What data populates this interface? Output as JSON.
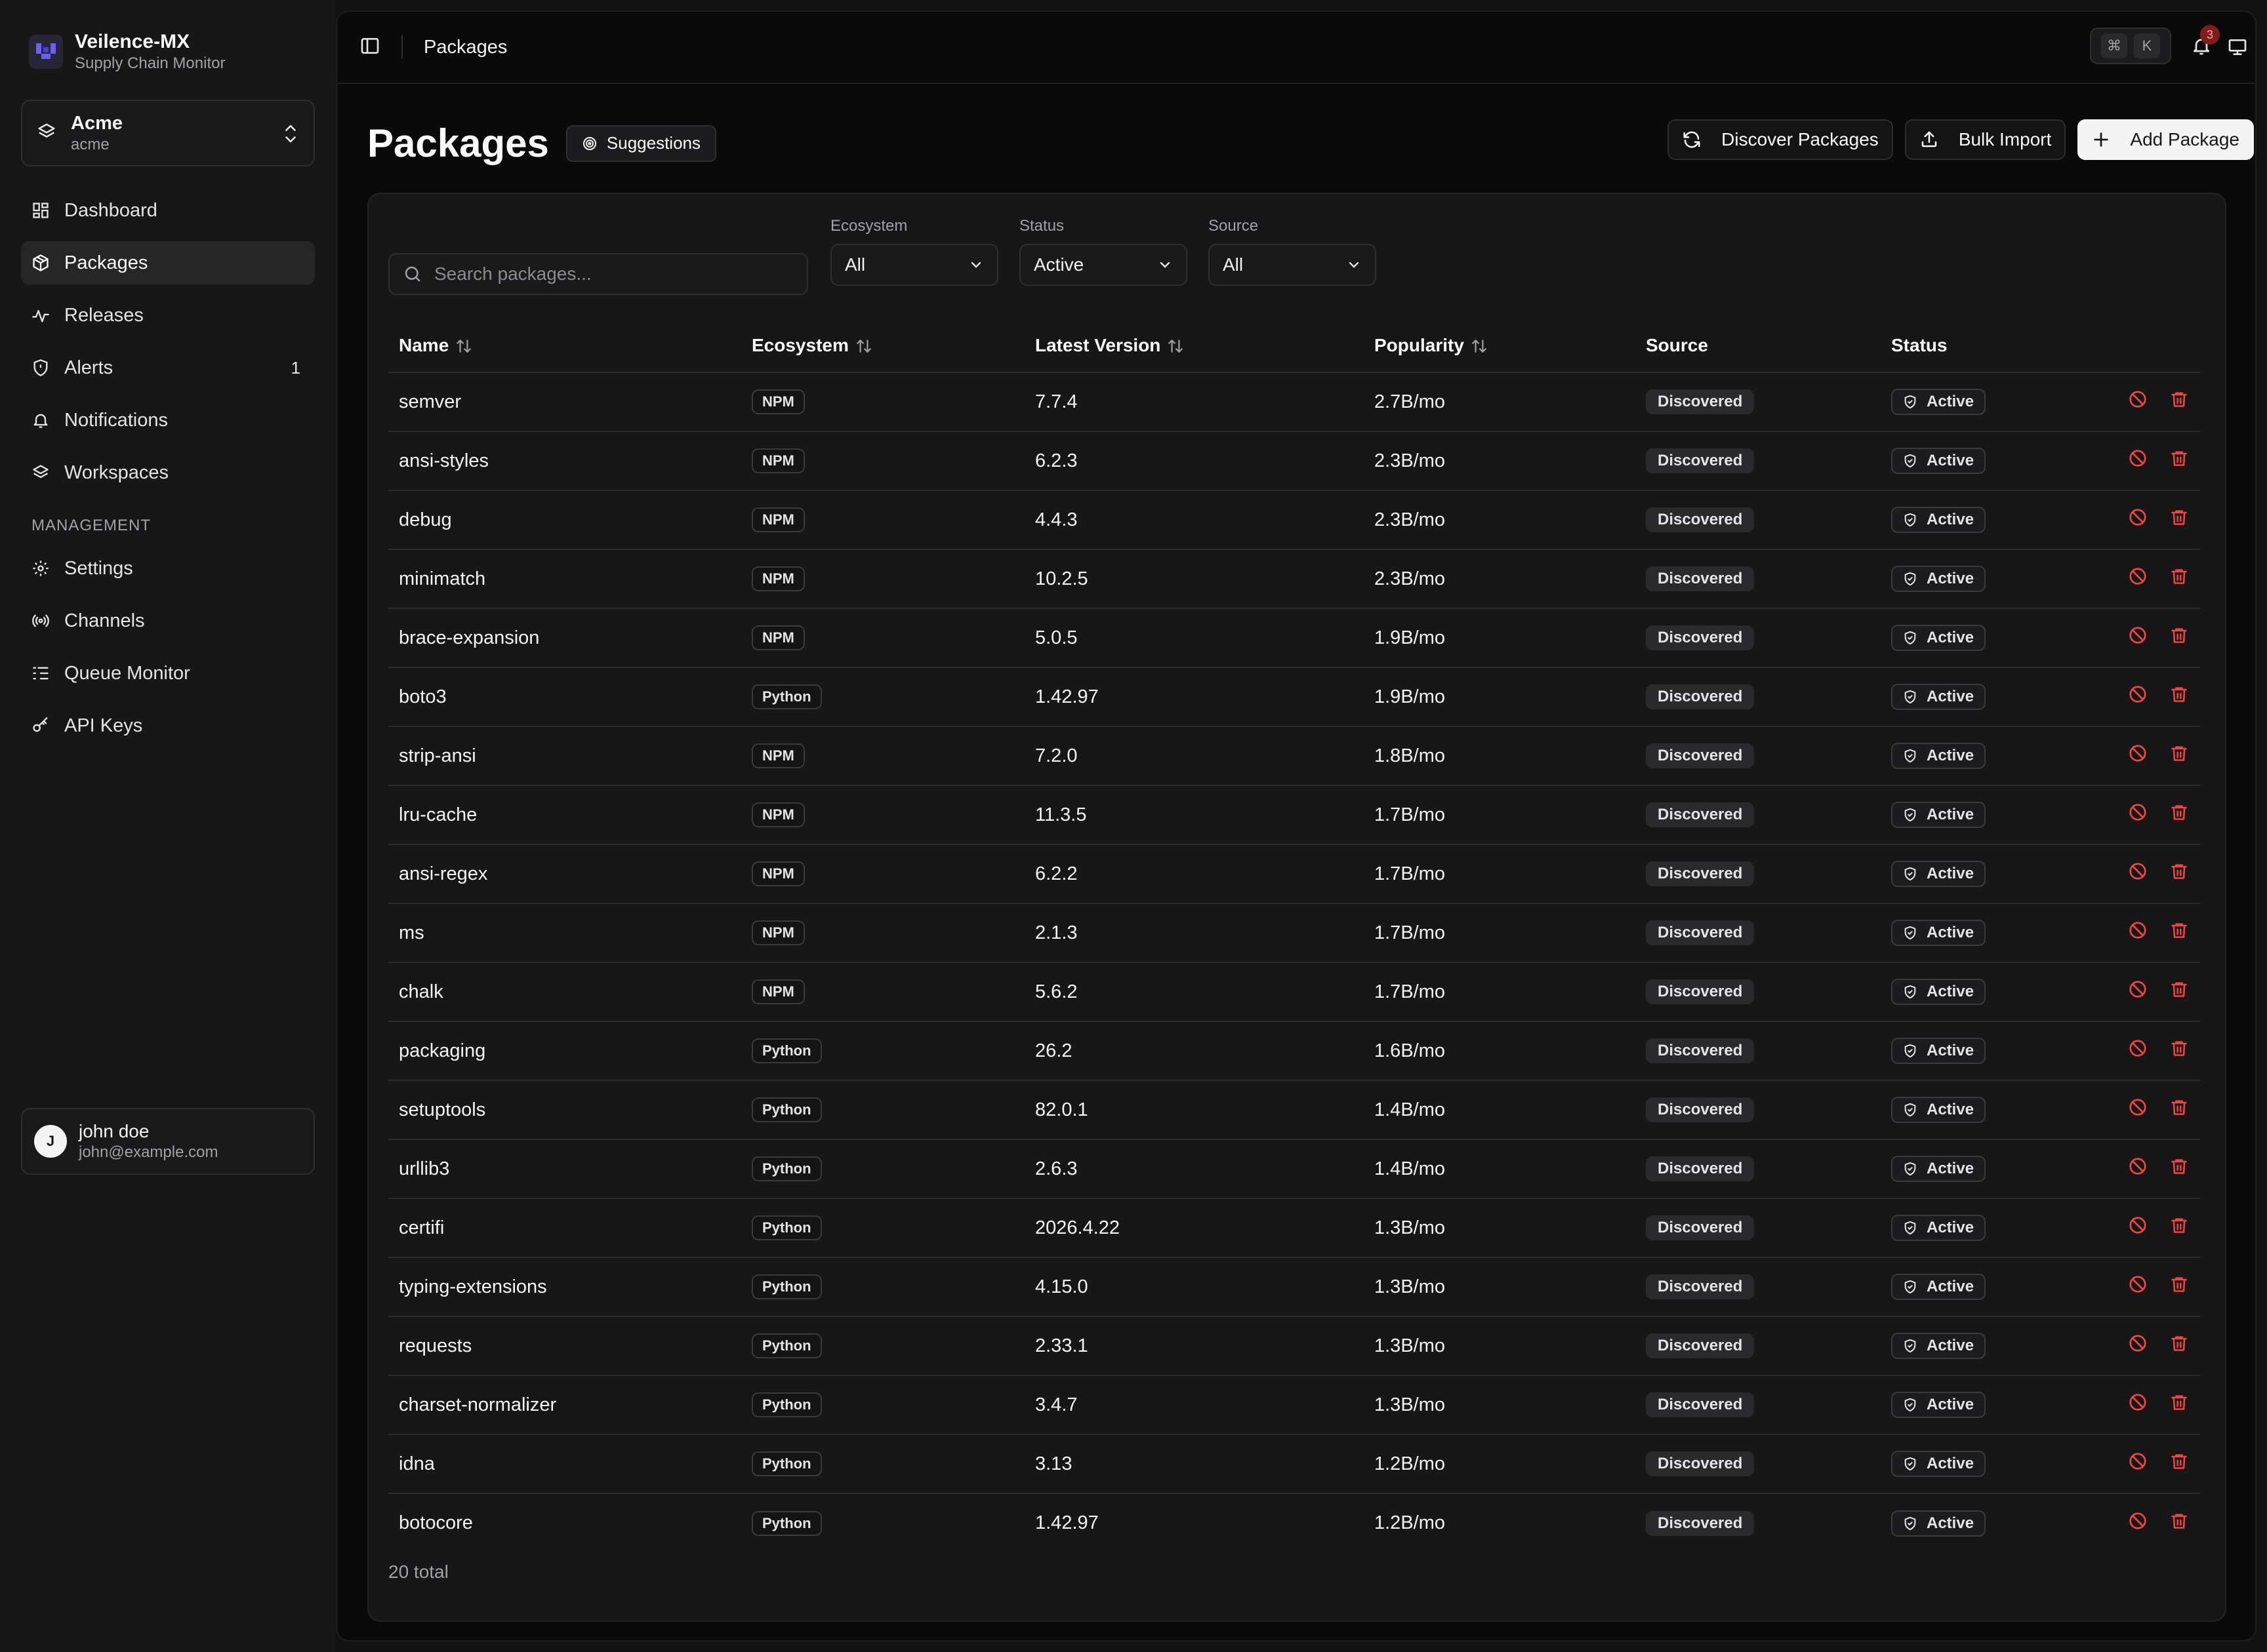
{
  "brand": {
    "name": "Veilence-MX",
    "subtitle": "Supply Chain Monitor"
  },
  "workspace": {
    "name": "Acme",
    "slug": "acme"
  },
  "sidebar": {
    "items": [
      {
        "label": "Dashboard",
        "icon": "dashboard-icon"
      },
      {
        "label": "Packages",
        "icon": "package-icon",
        "active": true
      },
      {
        "label": "Releases",
        "icon": "activity-icon"
      },
      {
        "label": "Alerts",
        "icon": "shield-icon",
        "badge": "1"
      },
      {
        "label": "Notifications",
        "icon": "bell-icon"
      },
      {
        "label": "Workspaces",
        "icon": "layers-icon"
      }
    ],
    "section_label": "MANAGEMENT",
    "management": [
      {
        "label": "Settings",
        "icon": "gear-icon"
      },
      {
        "label": "Channels",
        "icon": "broadcast-icon"
      },
      {
        "label": "Queue Monitor",
        "icon": "list-icon"
      },
      {
        "label": "API Keys",
        "icon": "key-icon"
      }
    ]
  },
  "user": {
    "initial": "J",
    "name": "john doe",
    "email": "john@example.com"
  },
  "topbar": {
    "breadcrumb": "Packages",
    "kbd_mod": "⌘",
    "kbd_key": "K",
    "notification_count": "3"
  },
  "page": {
    "title": "Packages",
    "suggestions_label": "Suggestions",
    "discover_label": "Discover Packages",
    "bulk_import_label": "Bulk Import",
    "add_label": "Add Package"
  },
  "filters": {
    "search_placeholder": "Search packages...",
    "ecosystem": {
      "label": "Ecosystem",
      "value": "All"
    },
    "status": {
      "label": "Status",
      "value": "Active"
    },
    "source": {
      "label": "Source",
      "value": "All"
    }
  },
  "table": {
    "columns": [
      "Name",
      "Ecosystem",
      "Latest Version",
      "Popularity",
      "Source",
      "Status"
    ],
    "rows": [
      {
        "name": "semver",
        "ecosystem": "NPM",
        "version": "7.7.4",
        "popularity": "2.7B/mo",
        "source": "Discovered",
        "status": "Active"
      },
      {
        "name": "ansi-styles",
        "ecosystem": "NPM",
        "version": "6.2.3",
        "popularity": "2.3B/mo",
        "source": "Discovered",
        "status": "Active"
      },
      {
        "name": "debug",
        "ecosystem": "NPM",
        "version": "4.4.3",
        "popularity": "2.3B/mo",
        "source": "Discovered",
        "status": "Active"
      },
      {
        "name": "minimatch",
        "ecosystem": "NPM",
        "version": "10.2.5",
        "popularity": "2.3B/mo",
        "source": "Discovered",
        "status": "Active"
      },
      {
        "name": "brace-expansion",
        "ecosystem": "NPM",
        "version": "5.0.5",
        "popularity": "1.9B/mo",
        "source": "Discovered",
        "status": "Active"
      },
      {
        "name": "boto3",
        "ecosystem": "Python",
        "version": "1.42.97",
        "popularity": "1.9B/mo",
        "source": "Discovered",
        "status": "Active"
      },
      {
        "name": "strip-ansi",
        "ecosystem": "NPM",
        "version": "7.2.0",
        "popularity": "1.8B/mo",
        "source": "Discovered",
        "status": "Active"
      },
      {
        "name": "lru-cache",
        "ecosystem": "NPM",
        "version": "11.3.5",
        "popularity": "1.7B/mo",
        "source": "Discovered",
        "status": "Active"
      },
      {
        "name": "ansi-regex",
        "ecosystem": "NPM",
        "version": "6.2.2",
        "popularity": "1.7B/mo",
        "source": "Discovered",
        "status": "Active"
      },
      {
        "name": "ms",
        "ecosystem": "NPM",
        "version": "2.1.3",
        "popularity": "1.7B/mo",
        "source": "Discovered",
        "status": "Active"
      },
      {
        "name": "chalk",
        "ecosystem": "NPM",
        "version": "5.6.2",
        "popularity": "1.7B/mo",
        "source": "Discovered",
        "status": "Active"
      },
      {
        "name": "packaging",
        "ecosystem": "Python",
        "version": "26.2",
        "popularity": "1.6B/mo",
        "source": "Discovered",
        "status": "Active"
      },
      {
        "name": "setuptools",
        "ecosystem": "Python",
        "version": "82.0.1",
        "popularity": "1.4B/mo",
        "source": "Discovered",
        "status": "Active"
      },
      {
        "name": "urllib3",
        "ecosystem": "Python",
        "version": "2.6.3",
        "popularity": "1.4B/mo",
        "source": "Discovered",
        "status": "Active"
      },
      {
        "name": "certifi",
        "ecosystem": "Python",
        "version": "2026.4.22",
        "popularity": "1.3B/mo",
        "source": "Discovered",
        "status": "Active"
      },
      {
        "name": "typing-extensions",
        "ecosystem": "Python",
        "version": "4.15.0",
        "popularity": "1.3B/mo",
        "source": "Discovered",
        "status": "Active"
      },
      {
        "name": "requests",
        "ecosystem": "Python",
        "version": "2.33.1",
        "popularity": "1.3B/mo",
        "source": "Discovered",
        "status": "Active"
      },
      {
        "name": "charset-normalizer",
        "ecosystem": "Python",
        "version": "3.4.7",
        "popularity": "1.3B/mo",
        "source": "Discovered",
        "status": "Active"
      },
      {
        "name": "idna",
        "ecosystem": "Python",
        "version": "3.13",
        "popularity": "1.2B/mo",
        "source": "Discovered",
        "status": "Active"
      },
      {
        "name": "botocore",
        "ecosystem": "Python",
        "version": "1.42.97",
        "popularity": "1.2B/mo",
        "source": "Discovered",
        "status": "Active"
      }
    ],
    "total": "20 total"
  },
  "colors": {
    "danger": "#ef4444",
    "brand_accent": "#6d5dfc"
  }
}
